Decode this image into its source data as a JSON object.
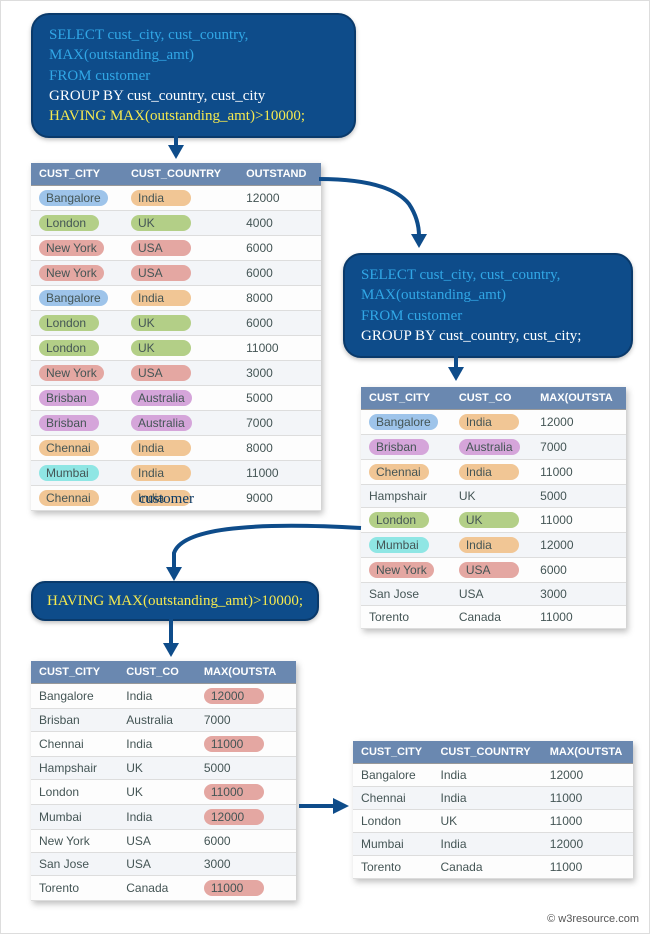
{
  "sql1": {
    "l1": "SELECT cust_city, cust_country,",
    "l2": "MAX(outstanding_amt)",
    "l3": "FROM customer",
    "l4": "GROUP BY cust_country, cust_city",
    "l5": "HAVING MAX(outstanding_amt)>10000;"
  },
  "sql2": {
    "l1": "SELECT cust_city, cust_country,",
    "l2": "MAX(outstanding_amt)",
    "l3": "FROM customer",
    "l4": "GROUP BY cust_country, cust_city;"
  },
  "sql3": {
    "text": "HAVING MAX(outstanding_amt)>10000;"
  },
  "table1": {
    "caption": "customer",
    "headers": [
      "CUST_CITY",
      "CUST_COUNTRY",
      "OUTSTAND"
    ],
    "rows": [
      {
        "city": "Bangalore",
        "c_city": "blue",
        "country": "India",
        "c_country": "orange",
        "amt": "12000"
      },
      {
        "city": "London",
        "c_city": "green",
        "country": "UK",
        "c_country": "green",
        "amt": "4000"
      },
      {
        "city": "New York",
        "c_city": "red",
        "country": "USA",
        "c_country": "red",
        "amt": "6000"
      },
      {
        "city": "New York",
        "c_city": "red",
        "country": "USA",
        "c_country": "red",
        "amt": "6000"
      },
      {
        "city": "Bangalore",
        "c_city": "blue",
        "country": "India",
        "c_country": "orange",
        "amt": "8000"
      },
      {
        "city": "London",
        "c_city": "green",
        "country": "UK",
        "c_country": "green",
        "amt": "6000"
      },
      {
        "city": "London",
        "c_city": "green",
        "country": "UK",
        "c_country": "green",
        "amt": "11000"
      },
      {
        "city": "New York",
        "c_city": "red",
        "country": "USA",
        "c_country": "red",
        "amt": "3000"
      },
      {
        "city": "Brisban",
        "c_city": "purple",
        "country": "Australia",
        "c_country": "purple",
        "amt": "5000"
      },
      {
        "city": "Brisban",
        "c_city": "purple",
        "country": "Australia",
        "c_country": "purple",
        "amt": "7000"
      },
      {
        "city": "Chennai",
        "c_city": "orange",
        "country": "India",
        "c_country": "orange",
        "amt": "8000"
      },
      {
        "city": "Mumbai",
        "c_city": "cyan",
        "country": "India",
        "c_country": "orange",
        "amt": "11000"
      },
      {
        "city": "Chennai",
        "c_city": "orange",
        "country": "India",
        "c_country": "orange",
        "amt": "9000"
      }
    ]
  },
  "table2": {
    "headers": [
      "CUST_CITY",
      "CUST_CO",
      "MAX(OUTSTA"
    ],
    "rows": [
      {
        "city": "Bangalore",
        "c_city": "blue",
        "country": "India",
        "c_country": "orange",
        "amt": "12000"
      },
      {
        "city": "Brisban",
        "c_city": "purple",
        "country": "Australia",
        "c_country": "purple",
        "amt": "7000"
      },
      {
        "city": "Chennai",
        "c_city": "orange",
        "country": "India",
        "c_country": "orange",
        "amt": "11000"
      },
      {
        "city": "Hampshair",
        "c_city": "",
        "country": "UK",
        "c_country": "",
        "amt": "5000"
      },
      {
        "city": "London",
        "c_city": "green",
        "country": "UK",
        "c_country": "green",
        "amt": "11000"
      },
      {
        "city": "Mumbai",
        "c_city": "cyan",
        "country": "India",
        "c_country": "orange",
        "amt": "12000"
      },
      {
        "city": "New York",
        "c_city": "red",
        "country": "USA",
        "c_country": "red",
        "amt": "6000"
      },
      {
        "city": "San Jose",
        "c_city": "",
        "country": "USA",
        "c_country": "",
        "amt": "3000"
      },
      {
        "city": "Torento",
        "c_city": "",
        "country": "Canada",
        "c_country": "",
        "amt": "11000"
      }
    ]
  },
  "table3": {
    "headers": [
      "CUST_CITY",
      "CUST_CO",
      "MAX(OUTSTA"
    ],
    "rows": [
      {
        "city": "Bangalore",
        "country": "India",
        "amt": "12000",
        "hl": true
      },
      {
        "city": "Brisban",
        "country": "Australia",
        "amt": "7000",
        "hl": false
      },
      {
        "city": "Chennai",
        "country": "India",
        "amt": "11000",
        "hl": true
      },
      {
        "city": "Hampshair",
        "country": "UK",
        "amt": "5000",
        "hl": false
      },
      {
        "city": "London",
        "country": "UK",
        "amt": "11000",
        "hl": true
      },
      {
        "city": "Mumbai",
        "country": "India",
        "amt": "12000",
        "hl": true
      },
      {
        "city": "New York",
        "country": "USA",
        "amt": "6000",
        "hl": false
      },
      {
        "city": "San Jose",
        "country": "USA",
        "amt": "3000",
        "hl": false
      },
      {
        "city": "Torento",
        "country": "Canada",
        "amt": "11000",
        "hl": true
      }
    ]
  },
  "table4": {
    "headers": [
      "CUST_CITY",
      "CUST_COUNTRY",
      "MAX(OUTSTA"
    ],
    "rows": [
      {
        "city": "Bangalore",
        "country": "India",
        "amt": "12000"
      },
      {
        "city": "Chennai",
        "country": "India",
        "amt": "11000"
      },
      {
        "city": "London",
        "country": "UK",
        "amt": "11000"
      },
      {
        "city": "Mumbai",
        "country": "India",
        "amt": "12000"
      },
      {
        "city": "Torento",
        "country": "Canada",
        "amt": "11000"
      }
    ]
  },
  "credit": "© w3resource.com"
}
